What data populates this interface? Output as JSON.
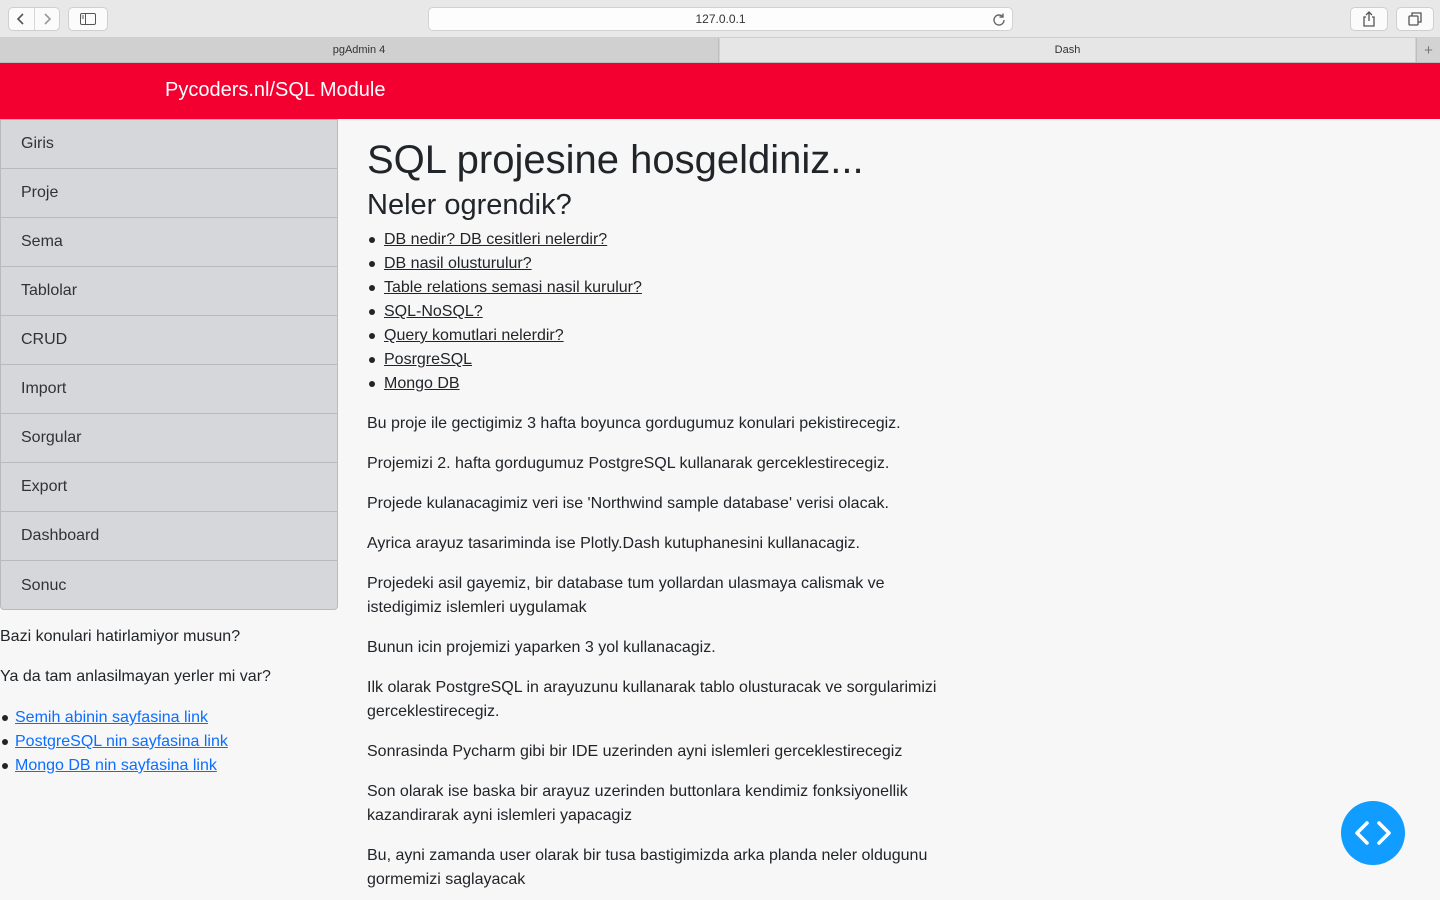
{
  "browser": {
    "url": "127.0.0.1",
    "tabs": [
      {
        "label": "pgAdmin 4"
      },
      {
        "label": "Dash"
      }
    ],
    "new_tab_label": "+"
  },
  "header": {
    "brand": "Pycoders.nl/SQL Module",
    "color": "#f30031"
  },
  "sidebar": {
    "items": [
      {
        "label": "Giris"
      },
      {
        "label": "Proje"
      },
      {
        "label": "Sema"
      },
      {
        "label": "Tablolar"
      },
      {
        "label": "CRUD"
      },
      {
        "label": "Import"
      },
      {
        "label": "Sorgular"
      },
      {
        "label": "Export"
      },
      {
        "label": "Dashboard"
      },
      {
        "label": "Sonuc"
      }
    ],
    "question_1": "Bazi konulari hatirlamiyor musun?",
    "question_2": "Ya da tam anlasilmayan yerler mi var?",
    "links": [
      {
        "label": "Semih abinin sayfasina link"
      },
      {
        "label": "PostgreSQL nin sayfasina link"
      },
      {
        "label": "Mongo DB nin sayfasina link"
      }
    ]
  },
  "main": {
    "title": "SQL projesine hosgeldiniz...",
    "subtitle": "Neler ogrendik?",
    "topics": [
      {
        "label": "DB nedir? DB cesitleri nelerdir?"
      },
      {
        "label": "DB nasil olusturulur?"
      },
      {
        "label": "Table relations semasi nasil kurulur?"
      },
      {
        "label": "SQL-NoSQL?"
      },
      {
        "label": "Query komutlari nelerdir?"
      },
      {
        "label": "PosrgreSQL"
      },
      {
        "label": "Mongo DB"
      }
    ],
    "paragraphs": [
      "Bu proje ile gectigimiz 3 hafta boyunca gordugumuz konulari pekistirecegiz.",
      "Projemizi 2. hafta gordugumuz PostgreSQL kullanarak gerceklestirecegiz.",
      "Projede kulanacagimiz veri ise 'Northwind sample database' verisi olacak.",
      "Ayrica arayuz tasariminda ise Plotly.Dash kutuphanesini kullanacagiz.",
      "Projedeki asil gayemiz, bir database tum yollardan ulasmaya calismak ve istedigimiz islemleri uygulamak",
      "Bunun icin projemizi yaparken 3 yol kullanacagiz.",
      "Ilk olarak PostgreSQL in arayuzunu kullanarak tablo olusturacak ve sorgularimizi gerceklestirecegiz.",
      "Sonrasinda Pycharm gibi bir IDE uzerinden ayni islemleri gerceklestirecegiz",
      "Son olarak ise baska bir arayuz uzerinden buttonlara kendimiz fonksiyonellik kazandirarak ayni islemleri yapacagiz",
      "Bu, ayni zamanda user olarak bir tusa bastigimizda arka planda neler oldugunu gormemizi saglayacak"
    ]
  },
  "dev_tools_button": {
    "icon": "code-brackets-icon",
    "color": "#119dff"
  }
}
